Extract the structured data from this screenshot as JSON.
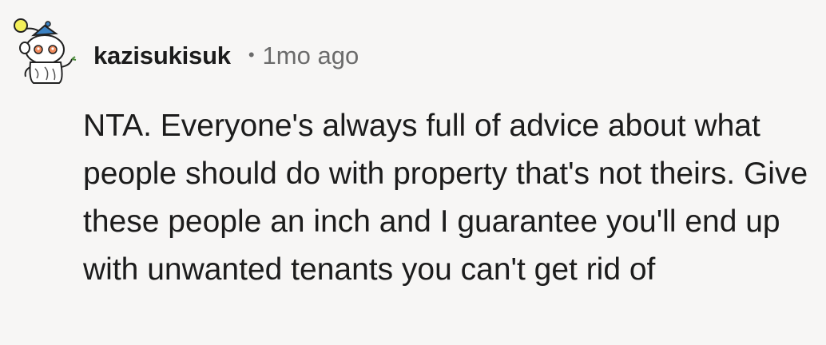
{
  "comment": {
    "author": "kazisukisuk",
    "separator": "•",
    "time_ago": "1mo ago",
    "avatar_icon": "snoo-avatar-icon",
    "body": "NTA. Everyone's always full of advice about what people should do with property that's not theirs. Give these people an inch and I guarantee you'll end up with unwanted tenants you can't get rid of"
  },
  "colors": {
    "background": "#f7f6f5",
    "text": "#1c1c1c",
    "muted": "#6b6b6b",
    "avatar_accent": "#e8e42a",
    "avatar_blue": "#3b82c4"
  }
}
